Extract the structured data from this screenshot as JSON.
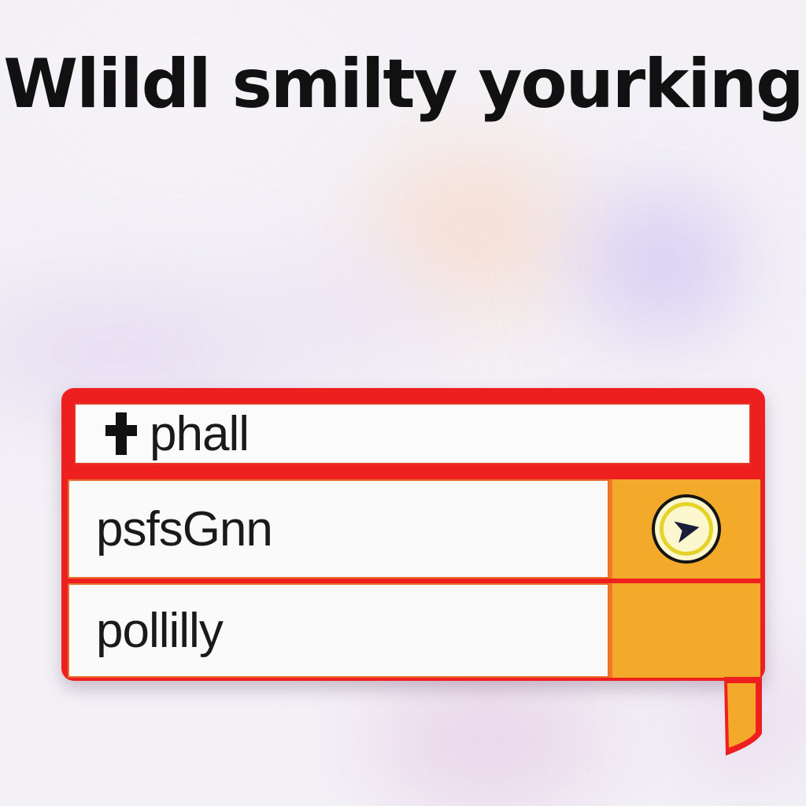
{
  "header": {
    "title": "Wlildl smilty yourking"
  },
  "panel": {
    "field": {
      "icon": "plus-icon",
      "value": "phall"
    },
    "rows": [
      {
        "label": "psfsGnn",
        "action_icon": "bird-badge-icon"
      },
      {
        "label": "pollilly",
        "action_icon": ""
      }
    ]
  },
  "colors": {
    "panel_border": "#ee1f1f",
    "action_fill": "#f3aa2a",
    "row_border": "#e8702c"
  }
}
